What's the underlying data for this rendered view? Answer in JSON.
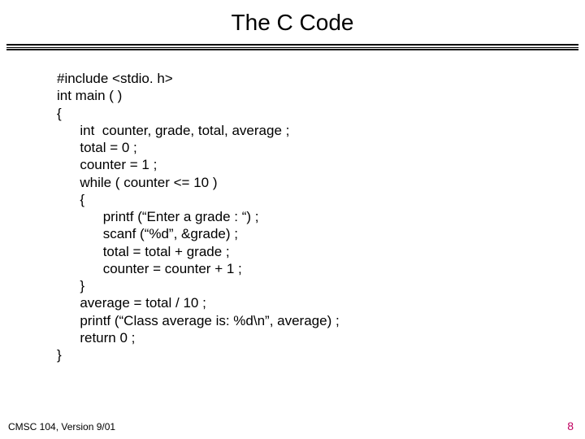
{
  "title": "The C Code",
  "code": {
    "l1": "#include <stdio. h>",
    "l2": "int main ( )",
    "l3": "{",
    "l4": "int  counter, grade, total, average ;",
    "l5": "total = 0 ;",
    "l6": "counter = 1 ;",
    "l7": "while ( counter <= 10 )",
    "l8": "{",
    "l9": "printf (“Enter a grade : “) ;",
    "l10": "scanf (“%d”, &grade) ;",
    "l11": "total = total + grade ;",
    "l12": "counter = counter + 1 ;",
    "l13": "}",
    "l14": "average = total / 10 ;",
    "l15": "printf (“Class average is: %d\\n”, average) ;",
    "l16": "return 0 ;",
    "l17": "}"
  },
  "footer": "CMSC 104, Version 9/01",
  "pagenum": "8"
}
